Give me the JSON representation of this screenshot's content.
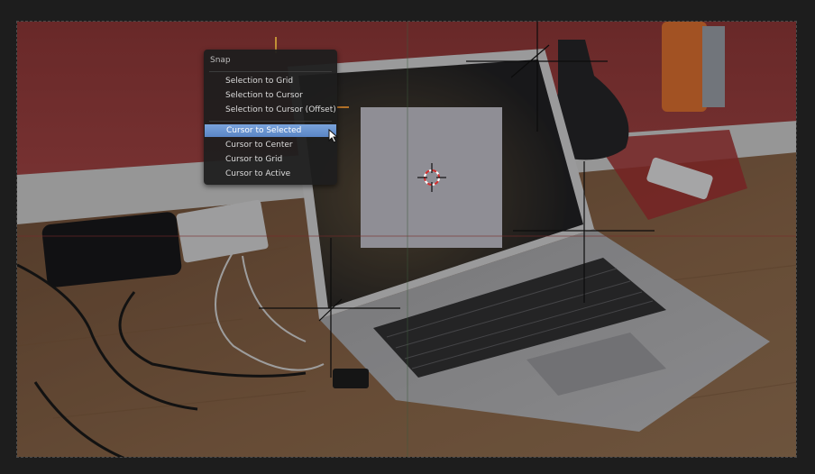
{
  "viewport": {
    "background_image": "photo of a laptop on a wooden desk with cables, a power adapter and a red wall"
  },
  "snap_menu": {
    "title": "Snap",
    "items": [
      {
        "label": "Selection to Grid"
      },
      {
        "label": "Selection to Cursor"
      },
      {
        "label": "Selection to Cursor (Offset)"
      },
      {
        "label": "Cursor to Selected",
        "highlighted": true
      },
      {
        "label": "Cursor to Center"
      },
      {
        "label": "Cursor to Grid"
      },
      {
        "label": "Cursor to Active"
      }
    ]
  },
  "colors": {
    "menu_background": "#1e1e1e",
    "highlight": "#5a85c5",
    "empty_image": "#8f8e95",
    "wall_red": "#9a3a3a",
    "desk_wood": "#8a6242"
  },
  "icons": [
    "3d-cursor-icon",
    "mouse-pointer-icon",
    "empty-axes-icon"
  ]
}
